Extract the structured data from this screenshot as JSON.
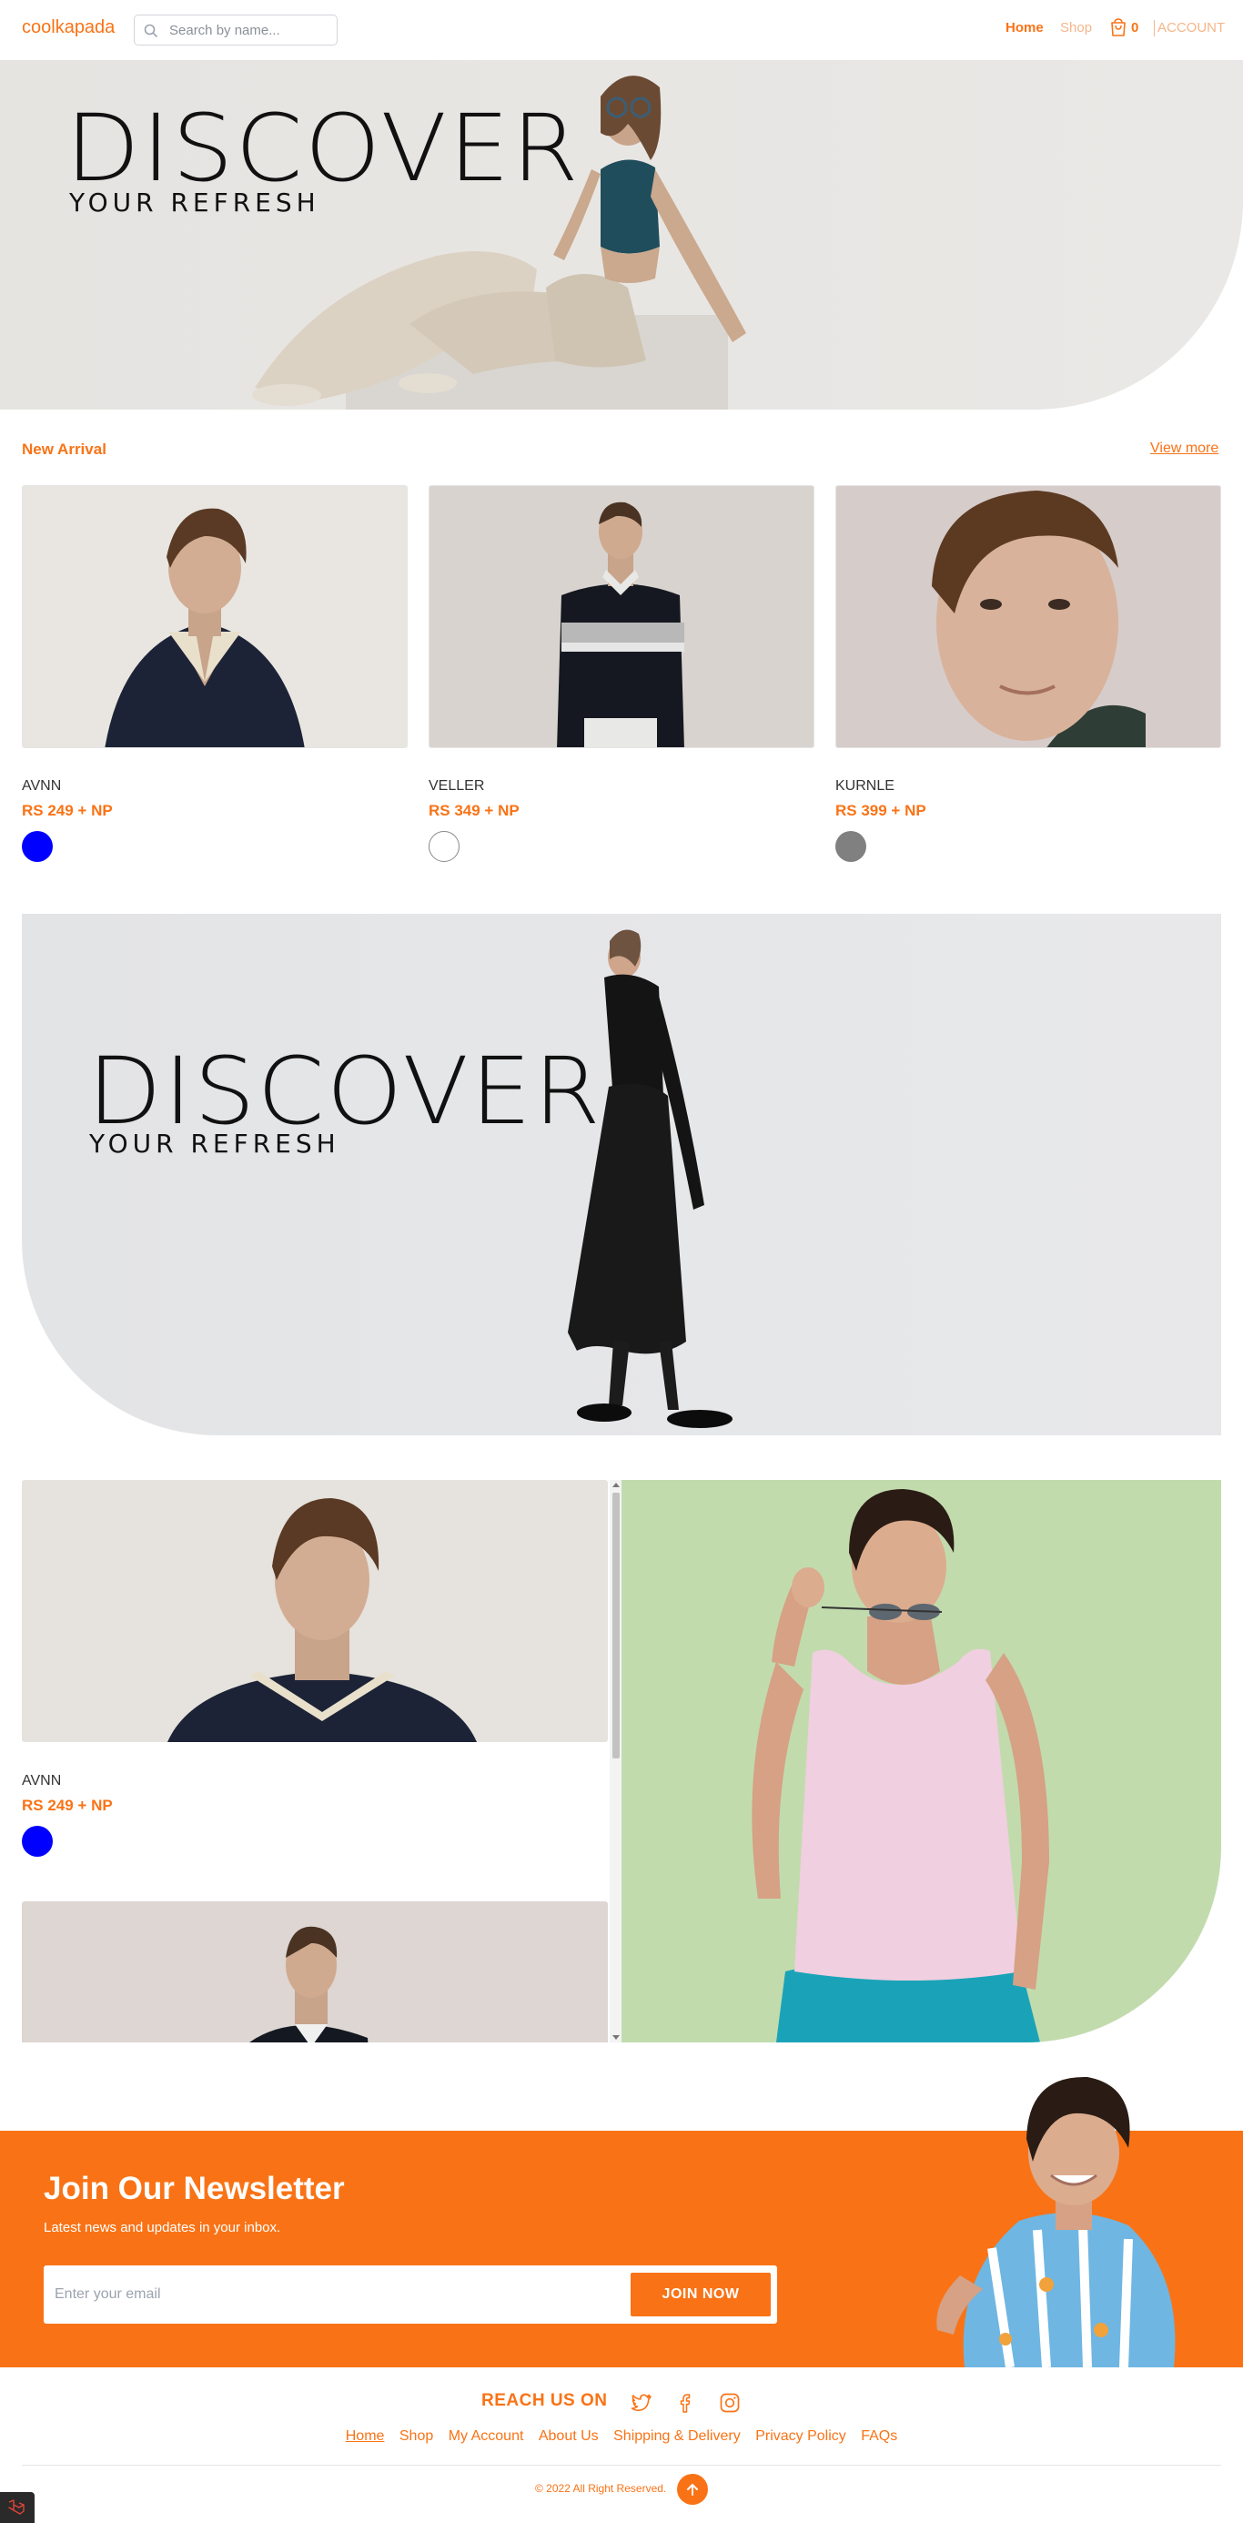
{
  "header": {
    "logo": "coolkapada",
    "search_placeholder": "Search by name...",
    "nav_home": "Home",
    "nav_shop": "Shop",
    "cart_count": "0",
    "account": "ACCOUNT"
  },
  "hero1": {
    "headline": "DISCOVER",
    "tagline": "YOUR REFRESH"
  },
  "new_arrival": {
    "title": "New Arrival",
    "view_more": "View more",
    "products": [
      {
        "name": "AVNN",
        "price": "RS 249 + NP",
        "swatch_color": "#0000ff"
      },
      {
        "name": "VELLER",
        "price": "RS 349 + NP",
        "swatch_color": "#ffffff"
      },
      {
        "name": "KURNLE",
        "price": "RS 399 + NP",
        "swatch_color": "#808080"
      }
    ]
  },
  "hero2": {
    "headline": "DISCOVER",
    "tagline": "YOUR REFRESH"
  },
  "featured_list": [
    {
      "name": "AVNN",
      "price": "RS 249 + NP",
      "swatch_color": "#0000ff"
    }
  ],
  "newsletter": {
    "title": "Join Our Newsletter",
    "subtitle": "Latest news and updates in your inbox.",
    "email_placeholder": "Enter your email",
    "button": "JOIN NOW"
  },
  "footer": {
    "reach_us": "REACH US ON",
    "social_icons": [
      "twitter-icon",
      "facebook-icon",
      "instagram-icon"
    ],
    "links": [
      "Home",
      "Shop",
      "My Account",
      "About Us",
      "Shipping & Delivery",
      "Privacy Policy",
      "FAQs"
    ],
    "copyright": "© 2022 All Right Reserved."
  },
  "colors": {
    "accent": "#f97316",
    "promo_green": "#c2dbad",
    "hero_grey": "#e6e4e1"
  }
}
